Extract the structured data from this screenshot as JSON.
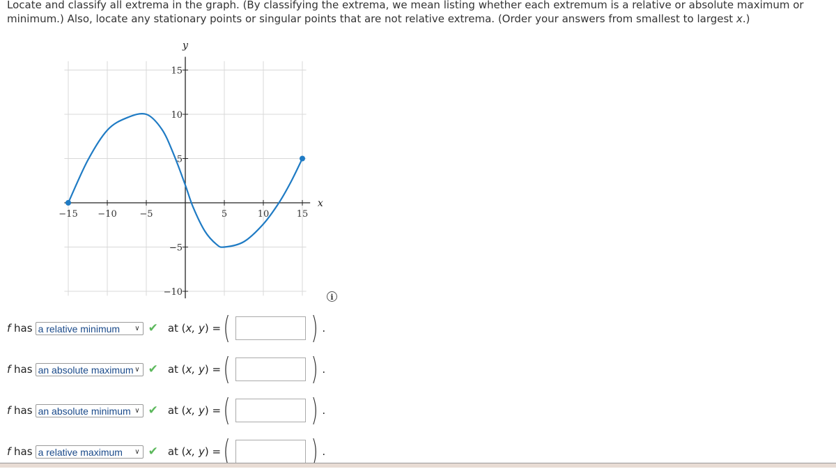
{
  "question": {
    "text_part1": "Locate and classify all extrema in the graph. (By classifying the extrema, we mean listing whether each extremum is a relative or absolute maximum or minimum.) Also, locate any stationary points or singular points that are not relative extrema. (Order your answers from smallest to largest ",
    "var": "x",
    "text_part2": ".)"
  },
  "chart_data": {
    "type": "line",
    "title": "",
    "xlabel": "x",
    "ylabel": "y",
    "xlim": [
      -16,
      16
    ],
    "ylim": [
      -11,
      16
    ],
    "xticks": [
      -15,
      -10,
      -5,
      5,
      10,
      15
    ],
    "xtick_labels": [
      "−15",
      "−10",
      "−5",
      "5",
      "10",
      "15"
    ],
    "yticks": [
      -10,
      -5,
      5,
      10,
      15
    ],
    "ytick_labels": [
      "−10",
      "−5",
      "5",
      "10",
      "15"
    ],
    "grid": true,
    "series": [
      {
        "name": "f",
        "color": "#1f7bc4",
        "points": [
          [
            -15,
            0
          ],
          [
            -12.5,
            4.8
          ],
          [
            -10,
            8.2
          ],
          [
            -7.5,
            9.6
          ],
          [
            -5,
            10
          ],
          [
            -3,
            8.3
          ],
          [
            -1.5,
            5.5
          ],
          [
            0,
            2
          ],
          [
            1,
            -0.5
          ],
          [
            2.5,
            -3.2
          ],
          [
            4,
            -4.7
          ],
          [
            5,
            -5
          ],
          [
            7.5,
            -4.4
          ],
          [
            10,
            -2.4
          ],
          [
            12,
            0
          ],
          [
            13.5,
            2.3
          ],
          [
            15,
            5
          ]
        ],
        "endpoints": [
          [
            -15,
            0
          ],
          [
            15,
            5
          ]
        ]
      }
    ]
  },
  "info_icon": "info-icon",
  "rows": [
    {
      "prefix_var": "f",
      "prefix": " has",
      "selected": "a relative minimum",
      "status": "correct",
      "at_label": "at (",
      "at_vars": "x, y",
      "at_end": ") =",
      "value": "",
      "suffix": "."
    },
    {
      "prefix_var": "f",
      "prefix": " has",
      "selected": "an absolute maximum",
      "status": "correct",
      "at_label": "at (",
      "at_vars": "x, y",
      "at_end": ") =",
      "value": "",
      "suffix": "."
    },
    {
      "prefix_var": "f",
      "prefix": " has",
      "selected": "an absolute minimum",
      "status": "correct",
      "at_label": "at (",
      "at_vars": "x, y",
      "at_end": ") =",
      "value": "",
      "suffix": "."
    },
    {
      "prefix_var": "f",
      "prefix": " has",
      "selected": "a relative maximum",
      "status": "correct",
      "at_label": "at (",
      "at_vars": "x, y",
      "at_end": ") =",
      "value": "",
      "suffix": "."
    }
  ],
  "colors": {
    "curve": "#1f7bc4",
    "check": "#5cb85c"
  }
}
